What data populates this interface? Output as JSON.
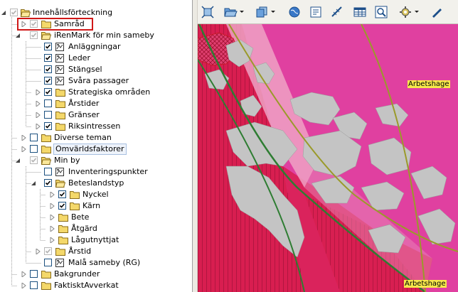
{
  "tree": {
    "items": [
      {
        "label": "Innehållsförteckning",
        "icon": "folder-open-icon"
      },
      {
        "label": "Samråd",
        "icon": "folder-icon"
      },
      {
        "label": "iRenMark för min sameby",
        "icon": "folder-open-icon"
      },
      {
        "label": "Anläggningar",
        "icon": "layer-icon"
      },
      {
        "label": "Leder",
        "icon": "layer-icon"
      },
      {
        "label": "Stängsel",
        "icon": "layer-icon"
      },
      {
        "label": "Svåra passager",
        "icon": "layer-icon"
      },
      {
        "label": "Strategiska områden",
        "icon": "folder-icon"
      },
      {
        "label": "Årstider",
        "icon": "folder-icon"
      },
      {
        "label": "Gränser",
        "icon": "folder-icon"
      },
      {
        "label": "Riksintressen",
        "icon": "folder-icon"
      },
      {
        "label": "Diverse teman",
        "icon": "folder-icon"
      },
      {
        "label": "Omvärldsfaktorer",
        "icon": "folder-icon"
      },
      {
        "label": "Min by",
        "icon": "folder-open-icon"
      },
      {
        "label": "Inventeringspunkter",
        "icon": "layer-icon"
      },
      {
        "label": "Beteslandstyp",
        "icon": "folder-open-icon"
      },
      {
        "label": "Nyckel",
        "icon": "folder-icon"
      },
      {
        "label": "Kärn",
        "icon": "folder-icon"
      },
      {
        "label": "Bete",
        "icon": "folder-icon"
      },
      {
        "label": "Åtgärd",
        "icon": "folder-icon"
      },
      {
        "label": "Lågutnyttjat",
        "icon": "folder-icon"
      },
      {
        "label": "Årstid",
        "icon": "folder-icon"
      },
      {
        "label": "Malå sameby (RG)",
        "icon": "layer-icon"
      },
      {
        "label": "Bakgrunder",
        "icon": "folder-icon"
      },
      {
        "label": "FaktisktAvverkat",
        "icon": "folder-icon"
      }
    ]
  },
  "toolbar": {
    "buttons": [
      "fit-extent-icon",
      "open-folder-icon",
      "copy-icon",
      "globe-icon",
      "identify-icon",
      "measure-icon",
      "table-icon",
      "zoom-icon",
      "settings-icon",
      "pen-icon"
    ]
  },
  "map": {
    "labels": [
      "Arbetshage",
      "Arbetshage"
    ],
    "colors": {
      "magenta": "#e040a0",
      "crimson": "#d81e50",
      "green_border": "#2e7d32",
      "olive_line": "#9a9a2a",
      "land_gray": "#c4c4c4",
      "pink_corridor": "#eea2c4"
    }
  }
}
